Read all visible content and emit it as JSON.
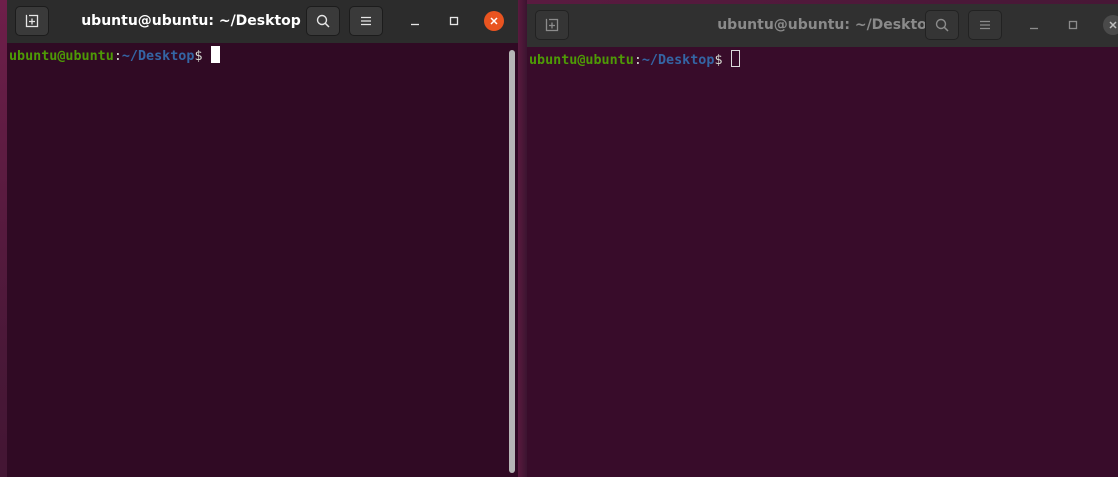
{
  "colors": {
    "terminal_bg": "#300a24",
    "prompt_user": "#4e9a06",
    "prompt_path": "#3465a4",
    "close_active": "#e95420"
  },
  "windows": [
    {
      "title": "ubuntu@ubuntu: ~/Desktop",
      "state": "focused",
      "icons": [
        "new-tab-icon",
        "search-icon",
        "hamburger-menu-icon",
        "minimize-icon",
        "maximize-icon",
        "close-icon"
      ],
      "prompt": {
        "user_host": "ubuntu@ubuntu",
        "colon": ":",
        "path": "~/Desktop",
        "symbol": "$"
      }
    },
    {
      "title": "ubuntu@ubuntu: ~/Desktop",
      "state": "unfocused",
      "icons": [
        "new-tab-icon",
        "search-icon",
        "hamburger-menu-icon",
        "minimize-icon",
        "maximize-icon",
        "close-icon"
      ],
      "prompt": {
        "user_host": "ubuntu@ubuntu",
        "colon": ":",
        "path": "~/Desktop",
        "symbol": "$"
      }
    }
  ]
}
